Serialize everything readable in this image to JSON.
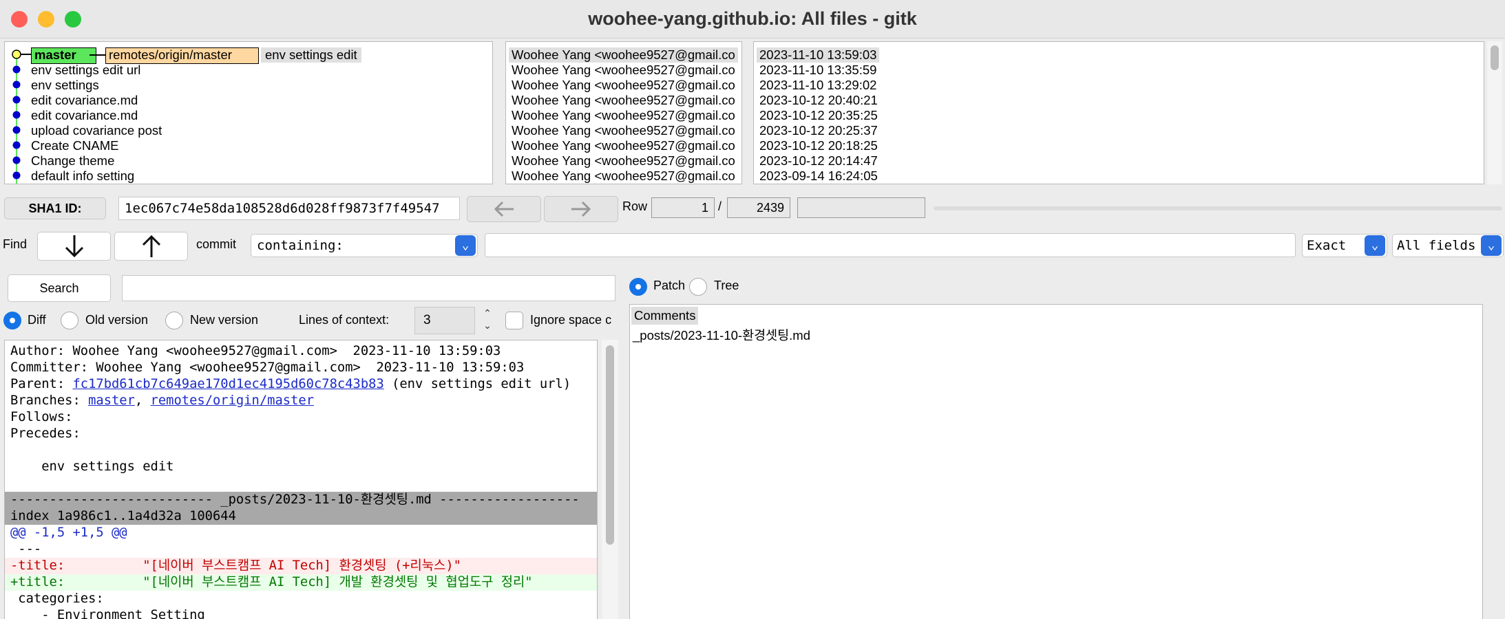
{
  "window": {
    "title": "woohee-yang.github.io: All files - gitk",
    "traffic_lights": {
      "close": "#ff5f57",
      "minimize": "#febc2e",
      "zoom": "#28c840"
    }
  },
  "commit_list": {
    "first_row": {
      "branch_local": "master",
      "branch_remote": "remotes/origin/master",
      "message": "env settings edit"
    },
    "messages": [
      "env settings edit url",
      "env settings",
      "edit covariance.md",
      "edit covariance.md",
      "upload covariance post",
      "Create CNAME",
      "Change theme",
      "default info setting"
    ],
    "authors": [
      "Woohee Yang <woohee9527@gmail.co",
      "Woohee Yang <woohee9527@gmail.co",
      "Woohee Yang <woohee9527@gmail.co",
      "Woohee Yang <woohee9527@gmail.co",
      "Woohee Yang <woohee9527@gmail.co",
      "Woohee Yang <woohee9527@gmail.co",
      "Woohee Yang <woohee9527@gmail.co",
      "Woohee Yang <woohee9527@gmail.co",
      "Woohee Yang <woohee9527@gmail.co"
    ],
    "dates": [
      "2023-11-10 13:59:03",
      "2023-11-10 13:35:59",
      "2023-11-10 13:29:02",
      "2023-10-12 20:40:21",
      "2023-10-12 20:35:25",
      "2023-10-12 20:25:37",
      "2023-10-12 20:18:25",
      "2023-10-12 20:14:47",
      "2023-09-14 16:24:05"
    ],
    "colors": {
      "local_branch": "#5ce65c",
      "remote_branch": "#ffd7a0",
      "graph_line": "#5ce65c",
      "node": "#0000cc",
      "head_node": "#ffff66"
    }
  },
  "sha_bar": {
    "label": "SHA1 ID:",
    "value": "1ec067c74e58da108528d6d028ff9873f7f49547",
    "back_icon": "arrow-left-icon",
    "forward_icon": "arrow-right-icon",
    "row_label": "Row",
    "row_current": "1",
    "row_sep": "/",
    "row_total": "2439"
  },
  "find_bar": {
    "label": "Find",
    "down_icon": "arrow-down-icon",
    "up_icon": "arrow-up-icon",
    "commit_label": "commit",
    "type_value": "containing:",
    "match_value": "Exact",
    "fields_value": "All fields"
  },
  "search": {
    "button_label": "Search"
  },
  "view_options": {
    "diff_label": "Diff",
    "old_label": "Old version",
    "new_label": "New version",
    "context_label": "Lines of context:",
    "context_value": "3",
    "ignore_label": "Ignore space c",
    "patch_label": "Patch",
    "tree_label": "Tree"
  },
  "details": {
    "author": "Author: Woohee Yang <woohee9527@gmail.com>  2023-11-10 13:59:03",
    "committer": "Committer: Woohee Yang <woohee9527@gmail.com>  2023-11-10 13:59:03",
    "parent_prefix": "Parent: ",
    "parent_sha": "fc17bd61cb7c649ae170d1ec4195d60c78c43b83",
    "parent_suffix": " (env settings edit url)",
    "branches_prefix": "Branches: ",
    "branch_1": "master",
    "branch_sep": ", ",
    "branch_2": "remotes/origin/master",
    "follows": "Follows:",
    "precedes": "Precedes:",
    "message": "    env settings edit",
    "file_header": "-------------------------- _posts/2023-11-10-환경셋팅.md ------------------",
    "index_line": "index 1a986c1..1a4d32a 100644",
    "hunk": "@@ -1,5 +1,5 @@",
    "context_1": " ---",
    "removed": "-title:          \"[네이버 부스트캠프 AI Tech] 환경셋팅 (+리눅스)\"",
    "added": "+title:          \"[네이버 부스트캠프 AI Tech] 개발 환경셋팅 및 협업도구 정리\"",
    "context_2": " categories:",
    "context_3": "    - Environment Setting"
  },
  "files": {
    "header": "Comments",
    "items": [
      "_posts/2023-11-10-환경셋팅.md"
    ]
  }
}
